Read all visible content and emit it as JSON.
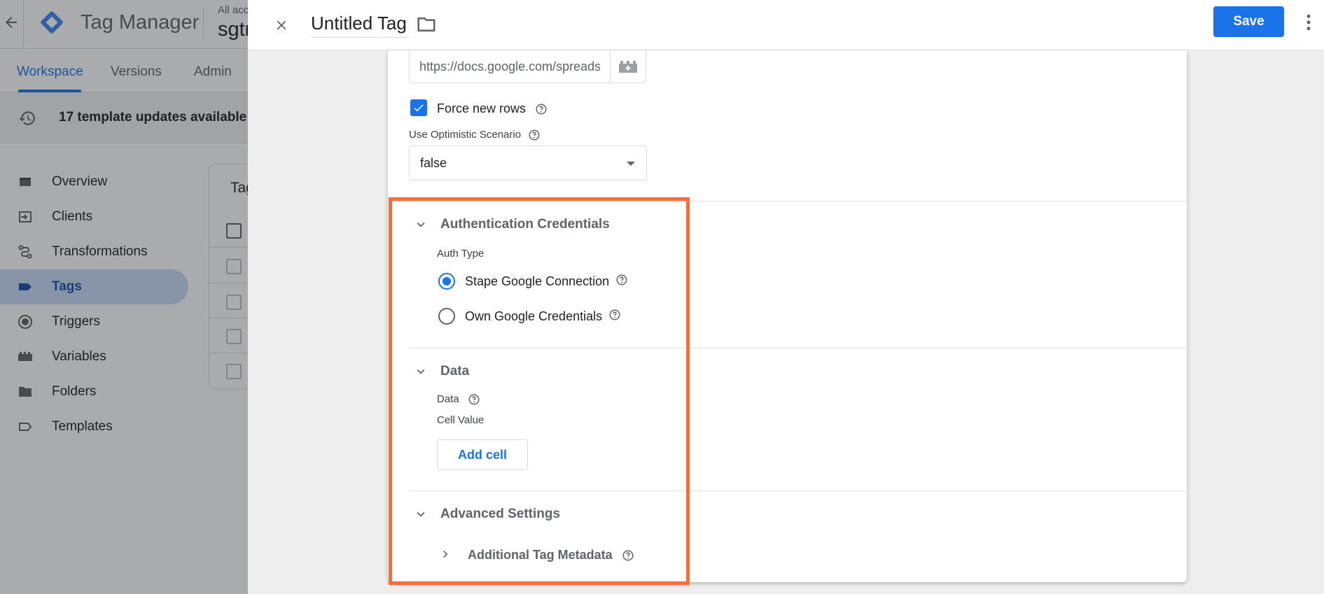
{
  "app": {
    "title": "Tag Manager",
    "account_label": "All acc",
    "container_name": "sgtr"
  },
  "tabs": [
    {
      "label": "Workspace",
      "active": true
    },
    {
      "label": "Versions",
      "active": false
    },
    {
      "label": "Admin",
      "active": false
    }
  ],
  "updates": {
    "text": "17 template updates available"
  },
  "nav": [
    {
      "label": "Overview",
      "icon": "overview-icon"
    },
    {
      "label": "Clients",
      "icon": "clients-icon"
    },
    {
      "label": "Transformations",
      "icon": "transformations-icon"
    },
    {
      "label": "Tags",
      "icon": "tag-icon",
      "active": true
    },
    {
      "label": "Triggers",
      "icon": "trigger-icon"
    },
    {
      "label": "Variables",
      "icon": "variables-icon"
    },
    {
      "label": "Folders",
      "icon": "folder-icon"
    },
    {
      "label": "Templates",
      "icon": "template-icon"
    }
  ],
  "tags_card": {
    "title": "Tag"
  },
  "sheet": {
    "tag_name": "Untitled Tag",
    "save_label": "Save"
  },
  "config": {
    "url_value": "https://docs.google.com/spreadsheets",
    "force_new_rows": {
      "label": "Force new rows",
      "checked": true
    },
    "optimistic": {
      "label": "Use Optimistic Scenario",
      "value": "false"
    },
    "auth": {
      "section_title": "Authentication Credentials",
      "auth_type_label": "Auth Type",
      "options": [
        {
          "label": "Stape Google Connection",
          "checked": true
        },
        {
          "label": "Own Google Credentials",
          "checked": false
        }
      ]
    },
    "data": {
      "section_title": "Data",
      "data_label": "Data",
      "cell_value_label": "Cell Value",
      "add_cell_label": "Add cell"
    },
    "advanced": {
      "section_title": "Advanced Settings",
      "metadata_label": "Additional Tag Metadata"
    }
  },
  "colors": {
    "accent": "#1a73e8",
    "highlight": "#ff6b35"
  }
}
